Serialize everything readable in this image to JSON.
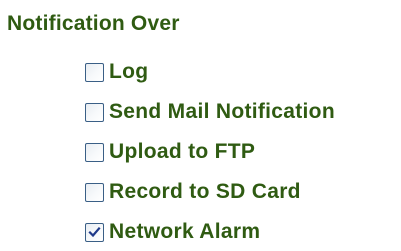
{
  "section": {
    "title": "Notification Over"
  },
  "options": [
    {
      "label": "Log",
      "checked": false
    },
    {
      "label": "Send Mail Notification",
      "checked": false
    },
    {
      "label": "Upload to FTP",
      "checked": false
    },
    {
      "label": "Record to SD Card",
      "checked": false
    },
    {
      "label": "Network Alarm",
      "checked": true
    }
  ],
  "colors": {
    "text": "#2f5b12",
    "checkbox_border": "#3a5f86",
    "checkmark": "#1f3a8a"
  }
}
